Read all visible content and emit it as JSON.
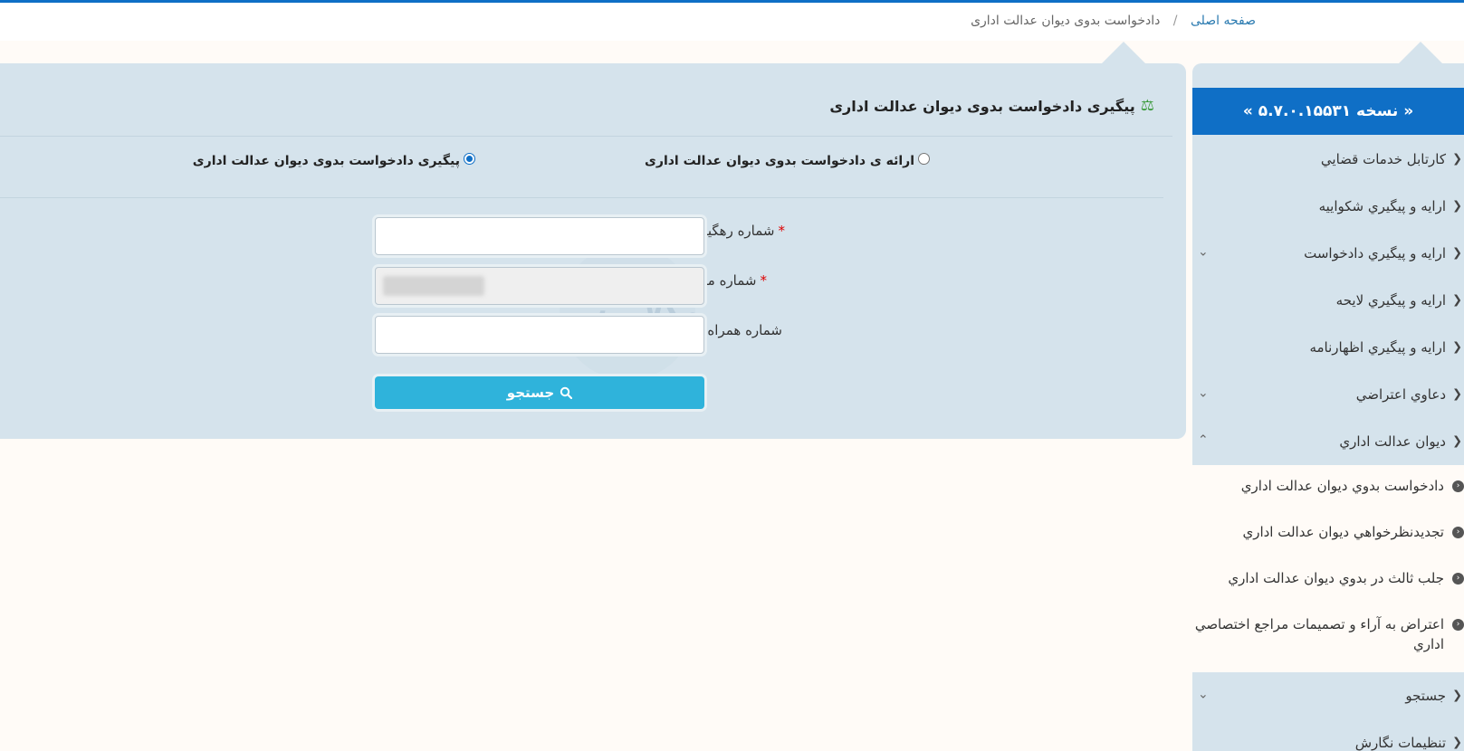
{
  "breadcrumb": {
    "home": "صفحه اصلی",
    "separator": "/",
    "current": "دادخواست بدوی دیوان عدالت اداری"
  },
  "version_label": "« نسخه ۵.۷.۰.۱۵۵۳۱ »",
  "sidebar": {
    "items": [
      {
        "label": "كارتابل خدمات قضايي",
        "toggle": ""
      },
      {
        "label": "ارايه و پيگيري شكواييه",
        "toggle": ""
      },
      {
        "label": "ارايه و پيگيري دادخواست",
        "toggle": "⌄"
      },
      {
        "label": "ارايه و پيگيري لايحه",
        "toggle": ""
      },
      {
        "label": "ارايه و پيگيري اظهارنامه",
        "toggle": ""
      },
      {
        "label": "دعاوي اعتراضي",
        "toggle": "⌄"
      },
      {
        "label": "ديوان عدالت اداري",
        "toggle": "⌃"
      }
    ],
    "subitems": [
      {
        "label": "دادخواست بدوي ديوان عدالت اداري"
      },
      {
        "label": "تجديدنظرخواهي ديوان عدالت اداري"
      },
      {
        "label": "جلب ثالث در بدوي ديوان عدالت اداري"
      },
      {
        "label": "اعتراض به آراء و تصميمات مراجع اختصاصي اداري"
      }
    ],
    "items_after": [
      {
        "label": "جستجو",
        "toggle": "⌄"
      },
      {
        "label": "تنظيمات نگارش",
        "toggle": ""
      }
    ]
  },
  "panel": {
    "title": "پیگیری دادخواست بدوی دیوان عدالت اداری",
    "radio_track": "پیگیری دادخواست بدوی دیوان عدالت اداری",
    "radio_submit": "ارائه ی دادخواست بدوی دیوان عدالت اداری",
    "field_tracking": "شماره رهگیری",
    "field_national": "شماره ملی",
    "field_mobile": "شماره همراه",
    "required_mark": "*",
    "search_button": "جستجو"
  },
  "watermark_text": "وکلاپرس",
  "colors": {
    "accent": "#0f6fc6",
    "button": "#2fb3db",
    "panel": "#d5e3ec",
    "background": "#fffbf7"
  }
}
